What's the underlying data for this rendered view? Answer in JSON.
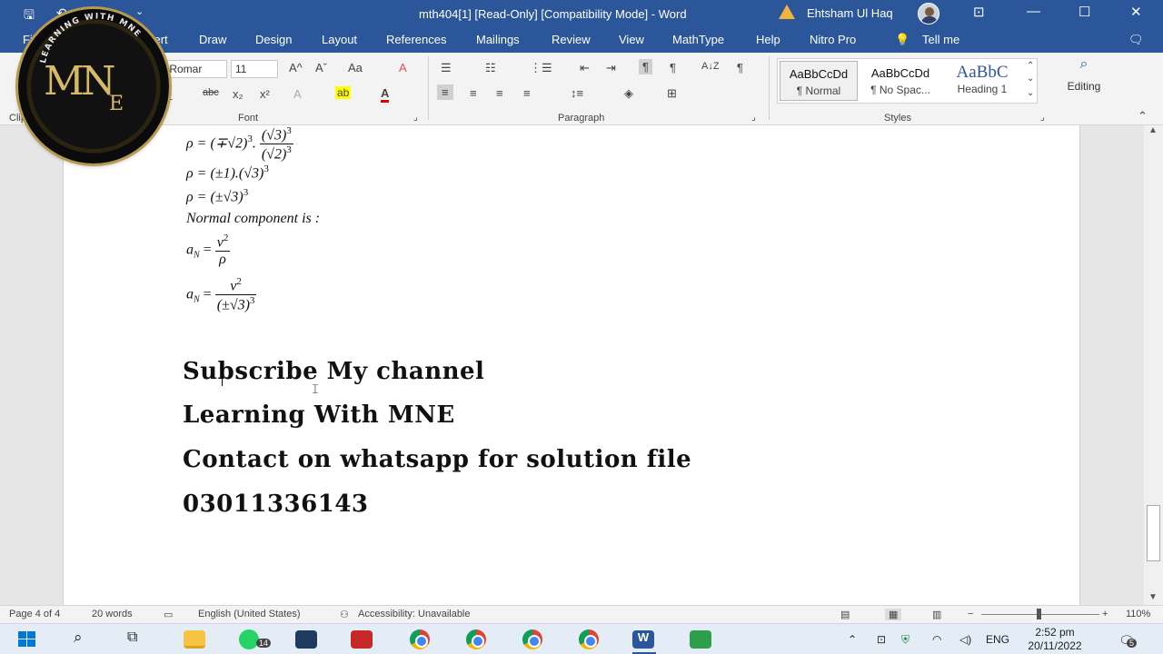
{
  "titlebar": {
    "title": "mth404[1] [Read-Only] [Compatibility Mode]  -  Word",
    "user": "Ehtsham Ul Haq",
    "qa_save": "🖫",
    "qa_undo": "↶",
    "qa_redo": "↷",
    "qa_more": "⌄",
    "restore_box": "⊡",
    "minimize": "—",
    "maximize": "☐",
    "close": "✕"
  },
  "menu": {
    "file": "Fil",
    "insert": "sert",
    "tabs": [
      "Draw",
      "Design",
      "Layout",
      "References",
      "Mailings",
      "Review",
      "View",
      "MathType",
      "Help",
      "Nitro Pro"
    ],
    "tell_me": "Tell me"
  },
  "ribbon": {
    "font_name": "v Romar",
    "font_size": "11",
    "groups": {
      "clipboard": "Clip",
      "font": "Font",
      "paragraph": "Paragraph",
      "styles": "Styles"
    },
    "styles": [
      {
        "sample": "AaBbCcDd",
        "name": "¶ Normal"
      },
      {
        "sample": "AaBbCcDd",
        "name": "¶ No Spac..."
      },
      {
        "sample": "AaBbC",
        "name": "Heading 1"
      }
    ],
    "editing": "Editing",
    "font_buttons": {
      "grow": "A^",
      "shrink": "Aˇ",
      "case": "Aa",
      "clear": "A",
      "underline": "U",
      "strike": "abc",
      "sub": "x₂",
      "sup": "x²",
      "effects": "A",
      "highlight": "ab",
      "color": "A"
    },
    "para_buttons": {
      "bullets": "☰",
      "numbering": "☷",
      "multilevel": "⋮☰",
      "dec_indent": "⇤",
      "inc_indent": "⇥",
      "ltr": "¶",
      "rtl": "¶",
      "sort": "A↓Z",
      "pilcrow": "¶",
      "align_left": "≡",
      "center": "≡",
      "right": "≡",
      "justify": "≡",
      "spacing": "↕≡",
      "shading": "◈",
      "borders": "⊞"
    },
    "colors": {
      "highlight": "#ffff00",
      "font_color": "#e00000"
    }
  },
  "document": {
    "math": {
      "line1_rho": "ρ = (∓√2)",
      "line1_exp": "3",
      "line1_num": "(√3)",
      "line1_num_exp": "3",
      "line1_den": "(√2)",
      "line1_den_exp": "3",
      "line2": "ρ = (±1).(√3)",
      "line2_exp": "3",
      "line3": "ρ = (±√3)",
      "line3_exp": "3",
      "line4": "Normal component is :",
      "line5_lhs": "a",
      "line5_sub": "N",
      "line5_eq": " = ",
      "line5_num": "v",
      "line5_num_exp": "2",
      "line5_den": "ρ",
      "line6_lhs": "a",
      "line6_sub": "N",
      "line6_eq": " = ",
      "line6_num": "v",
      "line6_num_exp": "2",
      "line6_den": "(±√3)",
      "line6_den_exp": "3"
    },
    "lines": [
      "Subscribe My channel",
      "Learning With MNE",
      "Contact on whatsapp for solution file",
      "03011336143"
    ]
  },
  "status": {
    "page": "Page 4 of 4",
    "words": "20 words",
    "language": "English (United States)",
    "accessibility": "Accessibility: Unavailable",
    "zoom": "110%",
    "zoom_minus": "−",
    "zoom_plus": "+"
  },
  "taskbar": {
    "whatsapp_badge": "14",
    "language": "ENG",
    "time": "2:52 pm",
    "date": "20/11/2022",
    "notifications": "5"
  },
  "logo": {
    "ring_text": "LEARNING WITH MNE",
    "mono": "MN",
    "sub": "E"
  }
}
